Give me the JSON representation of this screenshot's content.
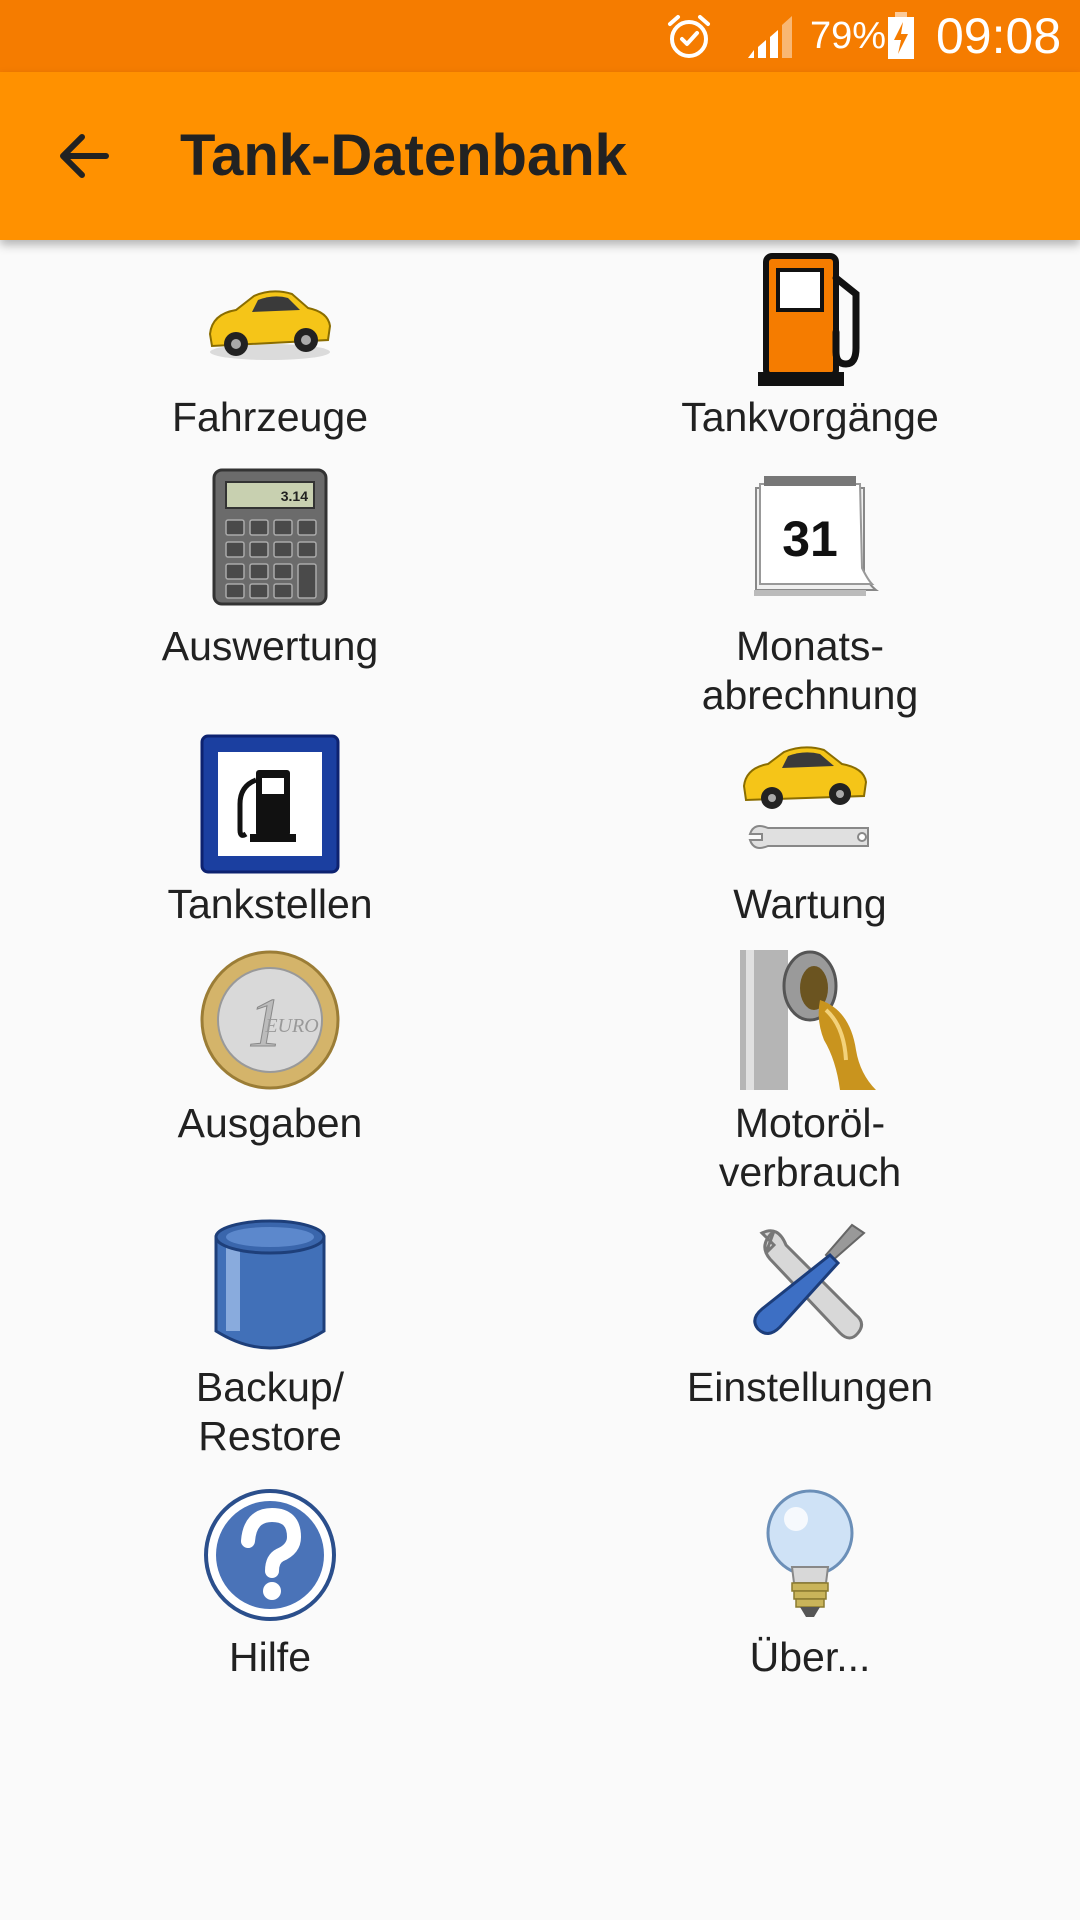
{
  "status_bar": {
    "battery_percent": "79%",
    "time": "09:08",
    "icons": [
      "alarm-icon",
      "signal-icon",
      "battery-charging-icon"
    ]
  },
  "toolbar": {
    "title": "Tank-Datenbank",
    "back_icon": "arrow-back-icon"
  },
  "menu": [
    {
      "label_1": "Fahrzeuge",
      "label_2": "",
      "icon": "car-icon"
    },
    {
      "label_1": "Tankvorgänge",
      "label_2": "",
      "icon": "fuel-pump-icon"
    },
    {
      "label_1": "Auswertung",
      "label_2": "",
      "icon": "calculator-icon",
      "calculator_display": "3.14"
    },
    {
      "label_1": "Monats-",
      "label_2": "abrechnung",
      "icon": "calendar-icon",
      "calendar_day": "31"
    },
    {
      "label_1": "Tankstellen",
      "label_2": "",
      "icon": "gas-station-sign-icon"
    },
    {
      "label_1": "Wartung",
      "label_2": "",
      "icon": "car-wrench-icon"
    },
    {
      "label_1": "Ausgaben",
      "label_2": "",
      "icon": "euro-coin-icon",
      "coin_value": "1",
      "coin_text": "EURO"
    },
    {
      "label_1": "Motoröl-",
      "label_2": "verbrauch",
      "icon": "oil-can-icon"
    },
    {
      "label_1": "Backup/",
      "label_2": "Restore",
      "icon": "database-icon"
    },
    {
      "label_1": "Einstellungen",
      "label_2": "",
      "icon": "tools-icon"
    },
    {
      "label_1": "Hilfe",
      "label_2": "",
      "icon": "help-icon"
    },
    {
      "label_1": "Über...",
      "label_2": "",
      "icon": "lightbulb-icon"
    }
  ]
}
